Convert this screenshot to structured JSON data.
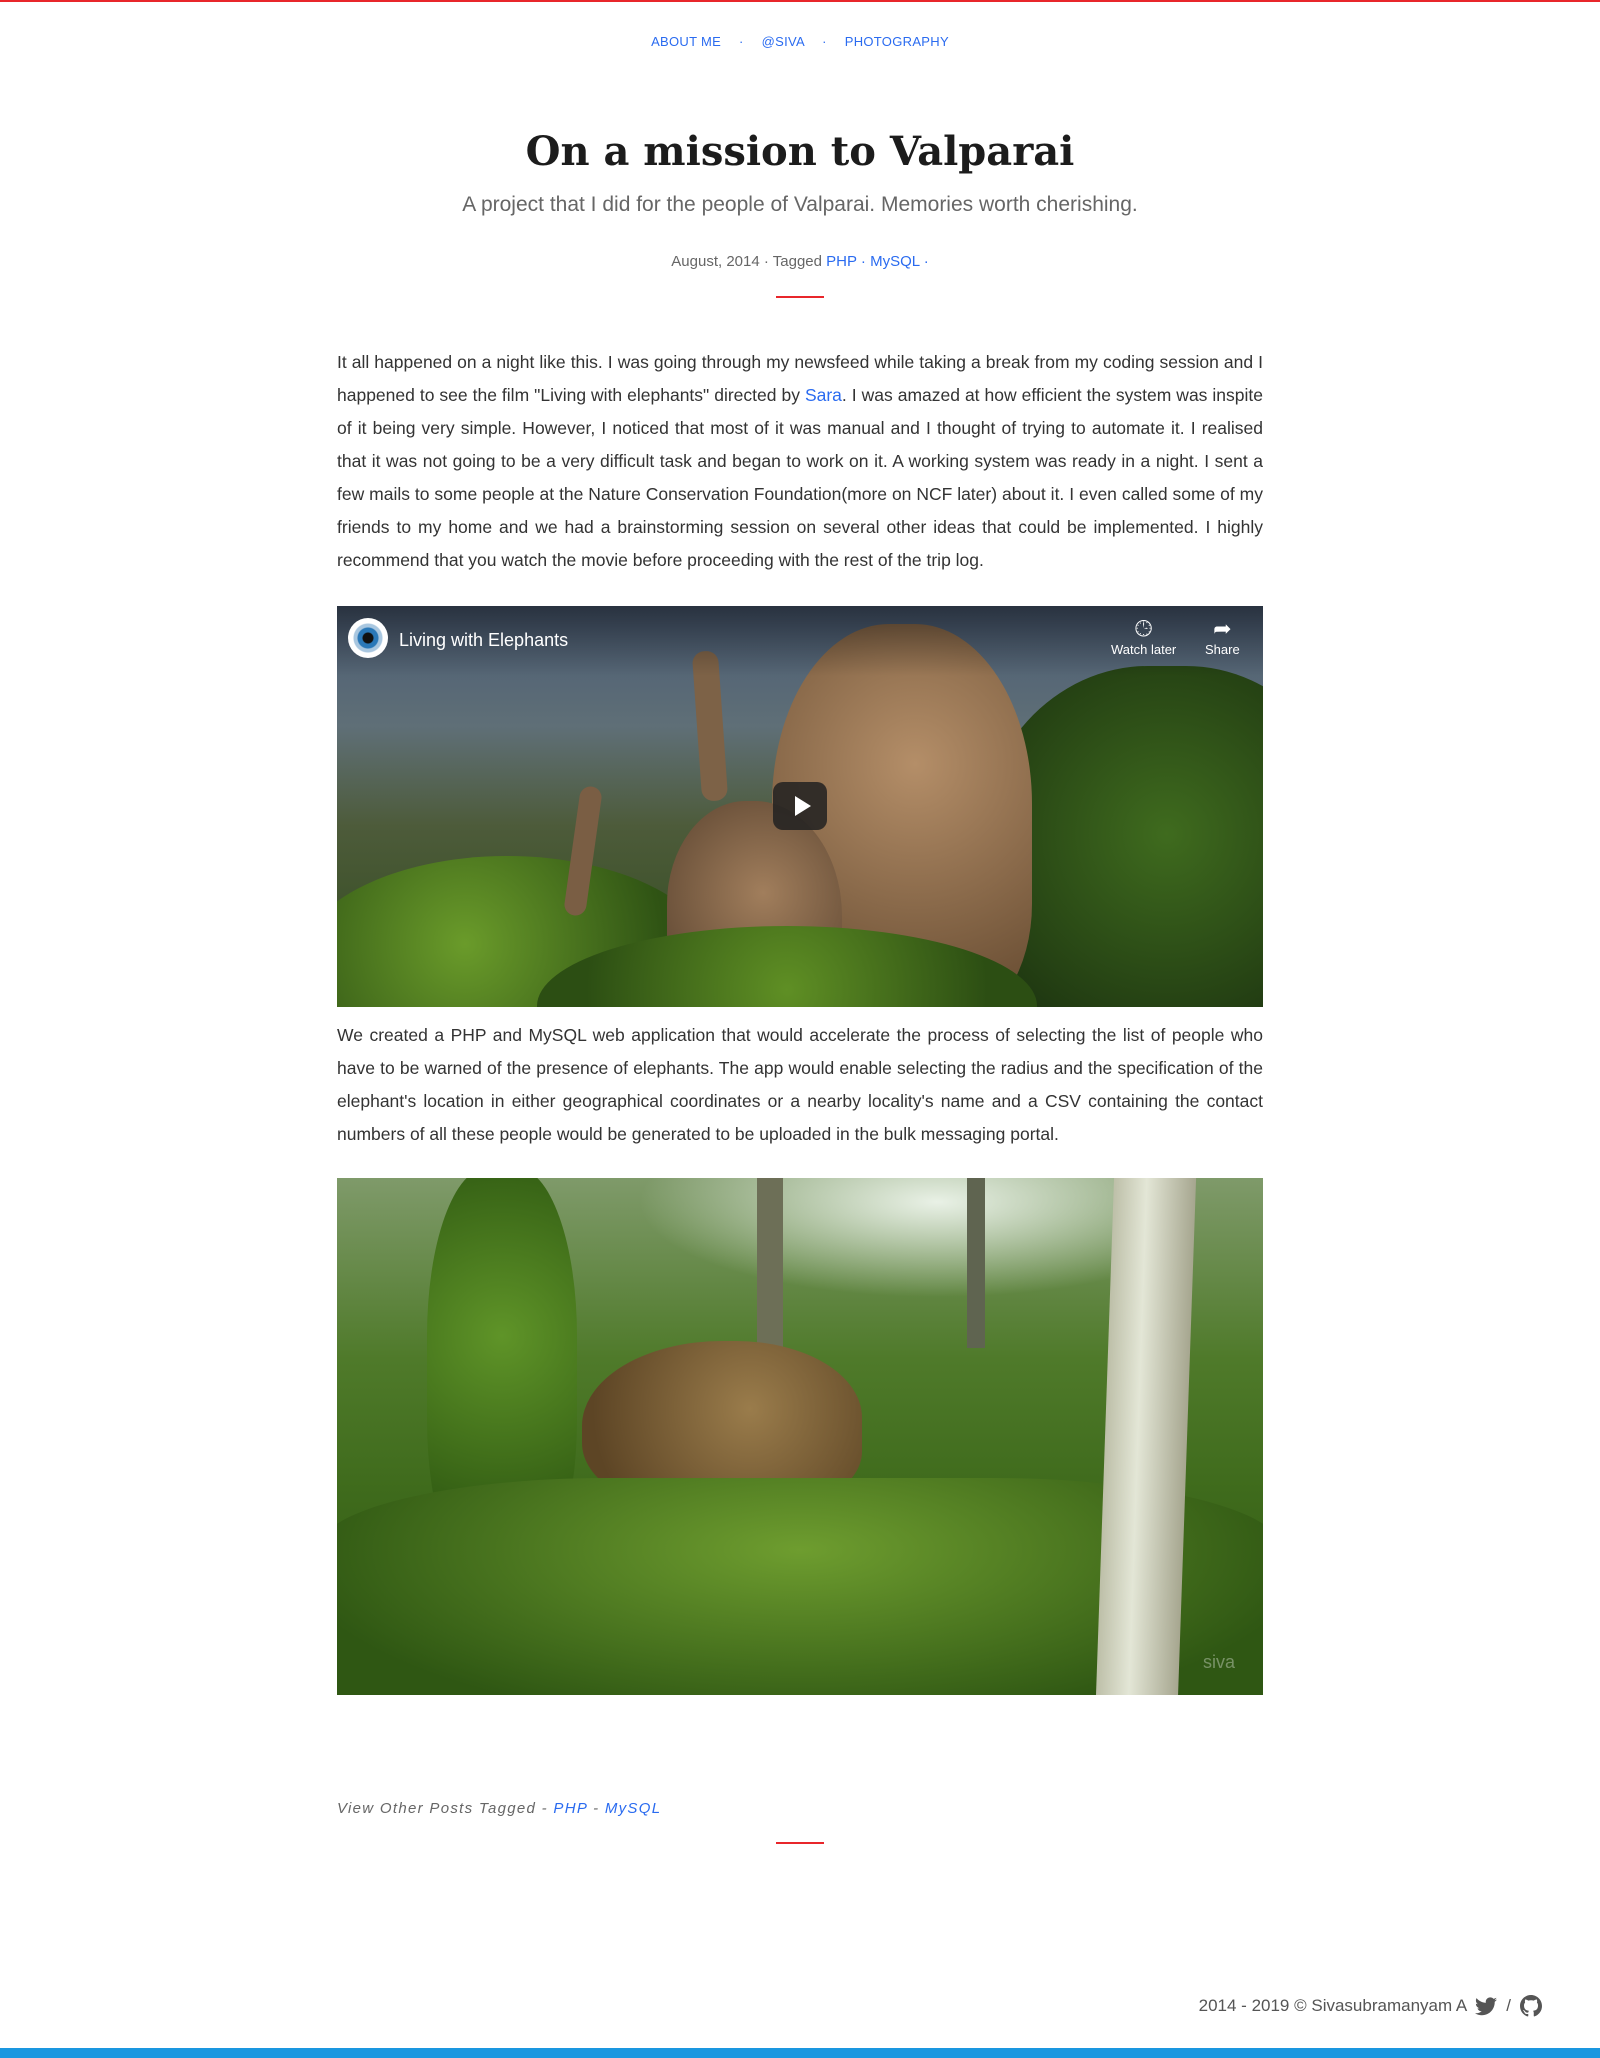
{
  "nav": {
    "items": [
      {
        "label": "About Me"
      },
      {
        "label": "@siva"
      },
      {
        "label": "Photography"
      }
    ],
    "separator": "·"
  },
  "post": {
    "title": "On a mission to Valparai",
    "subtitle": "A project that I did for the people of Valparai. Memories worth cherishing.",
    "meta": {
      "date": "August, 2014",
      "tagged_label": "Tagged",
      "tags": [
        "PHP",
        "MySQL"
      ],
      "sep": "·"
    },
    "para1": {
      "before_link": "It all happened on a night like this. I was going through my newsfeed while taking a break from my coding session and I happened to see the film \"Living with elephants\" directed by ",
      "link": "Sara",
      "after_link": ". I was amazed at how efficient the system was inspite of it being very simple. However, I noticed that most of it was manual and I thought of trying to automate it. I realised that it was not going to be a very difficult task and began to work on it. A working system was ready in a night. I sent a few mails to some people at the Nature Conservation Foundation(more on NCF later) about it. I even called some of my friends to my home and we had a brainstorming session on several other ideas that could be implemented. I highly recommend that you watch the movie before proceeding with the rest of the trip log."
    },
    "video": {
      "title": "Living with Elephants",
      "watch_later": "Watch later",
      "share": "Share",
      "clock_icon": "clock-icon",
      "share_icon": "share-arrow-icon",
      "play_icon": "play-icon"
    },
    "para2": "We created a PHP and MySQL web application that would accelerate the process of selecting the list of people who have to be warned of the presence of elephants. The app would enable selecting the radius and the specification of the elephant's location in either geographical coordinates or a nearby locality's name and a CSV containing the contact numbers of all these people would be generated to be uploaded in the bulk messaging portal.",
    "photo": {
      "watermark": "siva"
    },
    "tags_footer": {
      "label": "View Other Posts Tagged",
      "dash": "-",
      "tags": [
        "PHP",
        "MySQL"
      ]
    }
  },
  "footer": {
    "copyright": "2014 - 2019 © Sivasubramanyam A",
    "slash": "/",
    "icons": [
      "twitter-icon",
      "github-icon"
    ]
  },
  "colors": {
    "accent_red": "#e8262b",
    "link_blue": "#2a6bf0",
    "bottom_bar_blue": "#1a97e0"
  }
}
